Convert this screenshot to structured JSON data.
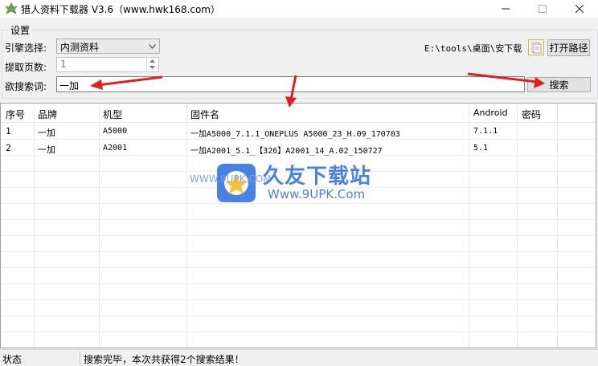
{
  "window": {
    "title": "猎人资料下载器 V3.6（www.hwk168.com）"
  },
  "settings": {
    "group_label": "设置",
    "engine_label": "引擎选择:",
    "engine_value": "内测资料",
    "pages_label": "提取页数:",
    "pages_value": "1",
    "keyword_label": "欲搜索词:",
    "keyword_value": "一加",
    "path_text": "E:\\tools\\桌面\\安下载",
    "open_path_label": "打开路径",
    "search_label": "搜索"
  },
  "table": {
    "columns": [
      "序号",
      "品牌",
      "机型",
      "固件名",
      "Android",
      "密码"
    ],
    "rows": [
      [
        "1",
        "一加",
        "A5000",
        "一加A5000_7.1.1_ONEPLUS A5000_23_H.09_170703",
        "7.1.1",
        ""
      ],
      [
        "2",
        "一加",
        "A2001",
        "一加A2001_5.1_【326】A2001_14_A.02_150727",
        "5.1",
        ""
      ]
    ]
  },
  "watermark": {
    "site_name": "久友下载站",
    "url": "Www.9UPK.Com",
    "side_text": "WWW.9UPK.COM"
  },
  "status": {
    "label": "状态",
    "message": "搜索完毕，本次共获得2个搜索结果！"
  },
  "colors": {
    "accent_red": "#e02020",
    "watermark_blue": "#1c64d9"
  }
}
